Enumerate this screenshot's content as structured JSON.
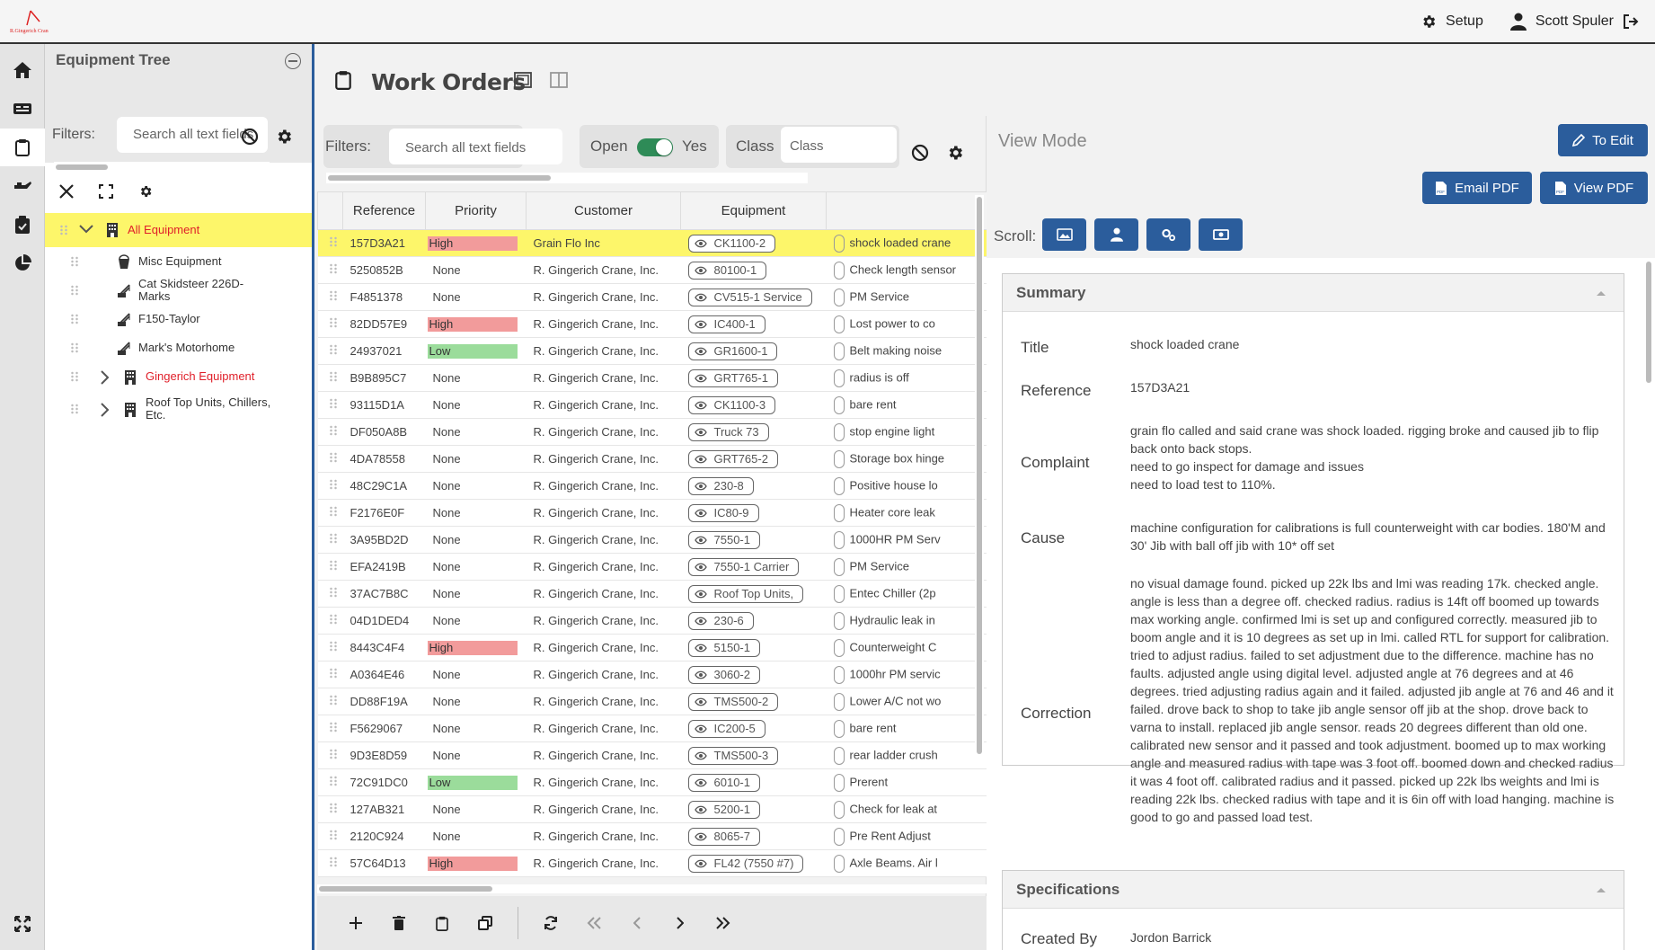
{
  "topbar": {
    "setup_label": "Setup",
    "user_name": "Scott Spuler"
  },
  "tree": {
    "title": "Equipment Tree",
    "filters_label": "Filters:",
    "search_placeholder": "Search all text fields",
    "items": [
      {
        "label": "All Equipment",
        "level": 0,
        "expanded": true,
        "selected": true,
        "icon": "building-icon",
        "color": "#e0202a"
      },
      {
        "label": "Misc Equipment",
        "level": 1,
        "icon": "bucket-icon",
        "color": "#333"
      },
      {
        "label": "Cat Skidsteer 226D- Marks",
        "level": 1,
        "icon": "crane-icon",
        "color": "#333"
      },
      {
        "label": "F150-Taylor",
        "level": 1,
        "icon": "crane-icon",
        "color": "#333"
      },
      {
        "label": "Mark's Motorhome",
        "level": 1,
        "icon": "crane-icon",
        "color": "#333"
      },
      {
        "label": "Gingerich Equipment",
        "level": 1,
        "collapsed": true,
        "icon": "building-icon",
        "color": "#e0202a"
      },
      {
        "label": "Roof Top Units, Chillers, Etc.",
        "level": 1,
        "collapsed": true,
        "icon": "building-icon",
        "color": "#333"
      }
    ]
  },
  "work_orders": {
    "title": "Work Orders",
    "filters_label": "Filters:",
    "search_placeholder": "Search all text fields",
    "open_label": "Open",
    "open_value": "Yes",
    "class_label": "Class",
    "class_placeholder": "Class",
    "columns": [
      "Reference",
      "Priority",
      "Customer",
      "Equipment"
    ],
    "rows": [
      {
        "ref": "157D3A21",
        "priority": "High",
        "customer": "Grain Flo Inc",
        "equipment": "CK1100-2",
        "desc": "shock loaded crane",
        "selected": true
      },
      {
        "ref": "5250852B",
        "priority": "None",
        "customer": "R. Gingerich Crane, Inc.",
        "equipment": "80100-1",
        "desc": "Check length sensor"
      },
      {
        "ref": "F4851378",
        "priority": "None",
        "customer": "R. Gingerich Crane, Inc.",
        "equipment": "CV515-1 Service",
        "desc": "PM Service"
      },
      {
        "ref": "82DD57E9",
        "priority": "High",
        "customer": "R. Gingerich Crane, Inc.",
        "equipment": "IC400-1",
        "desc": "Lost power to co"
      },
      {
        "ref": "24937021",
        "priority": "Low",
        "customer": "R. Gingerich Crane, Inc.",
        "equipment": "GR1600-1",
        "desc": "Belt making noise"
      },
      {
        "ref": "B9B895C7",
        "priority": "None",
        "customer": "R. Gingerich Crane, Inc.",
        "equipment": "GRT765-1",
        "desc": "radius is off"
      },
      {
        "ref": "93115D1A",
        "priority": "None",
        "customer": "R. Gingerich Crane, Inc.",
        "equipment": "CK1100-3",
        "desc": "bare rent"
      },
      {
        "ref": "DF050A8B",
        "priority": "None",
        "customer": "R. Gingerich Crane, Inc.",
        "equipment": "Truck 73",
        "desc": "stop engine light"
      },
      {
        "ref": "4DA78558",
        "priority": "None",
        "customer": "R. Gingerich Crane, Inc.",
        "equipment": "GRT765-2",
        "desc": "Storage box hinge"
      },
      {
        "ref": "48C29C1A",
        "priority": "None",
        "customer": "R. Gingerich Crane, Inc.",
        "equipment": "230-8",
        "desc": "Positive house lo"
      },
      {
        "ref": "F2176E0F",
        "priority": "None",
        "customer": "R. Gingerich Crane, Inc.",
        "equipment": "IC80-9",
        "desc": "Heater core leak"
      },
      {
        "ref": "3A95BD2D",
        "priority": "None",
        "customer": "R. Gingerich Crane, Inc.",
        "equipment": "7550-1",
        "desc": "1000HR PM Serv"
      },
      {
        "ref": "EFA2419B",
        "priority": "None",
        "customer": "R. Gingerich Crane, Inc.",
        "equipment": "7550-1 Carrier",
        "desc": "PM Service"
      },
      {
        "ref": "37AC7B8C",
        "priority": "None",
        "customer": "R. Gingerich Crane, Inc.",
        "equipment": "Roof Top Units,",
        "desc": "Entec Chiller (2p"
      },
      {
        "ref": "04D1DED4",
        "priority": "None",
        "customer": "R. Gingerich Crane, Inc.",
        "equipment": "230-6",
        "desc": "Hydraulic leak in"
      },
      {
        "ref": "8443C4F4",
        "priority": "High",
        "customer": "R. Gingerich Crane, Inc.",
        "equipment": "5150-1",
        "desc": "Counterweight C"
      },
      {
        "ref": "A0364E46",
        "priority": "None",
        "customer": "R. Gingerich Crane, Inc.",
        "equipment": "3060-2",
        "desc": "1000hr PM servic"
      },
      {
        "ref": "DD88F19A",
        "priority": "None",
        "customer": "R. Gingerich Crane, Inc.",
        "equipment": "TMS500-2",
        "desc": "Lower A/C not wo"
      },
      {
        "ref": "F5629067",
        "priority": "None",
        "customer": "R. Gingerich Crane, Inc.",
        "equipment": "IC200-5",
        "desc": "bare rent"
      },
      {
        "ref": "9D3E8D59",
        "priority": "None",
        "customer": "R. Gingerich Crane, Inc.",
        "equipment": "TMS500-3",
        "desc": "rear ladder crush"
      },
      {
        "ref": "72C91DC0",
        "priority": "Low",
        "customer": "R. Gingerich Crane, Inc.",
        "equipment": "6010-1",
        "desc": "Prerent"
      },
      {
        "ref": "127AB321",
        "priority": "None",
        "customer": "R. Gingerich Crane, Inc.",
        "equipment": "5200-1",
        "desc": "Check for leak at"
      },
      {
        "ref": "2120C924",
        "priority": "None",
        "customer": "R. Gingerich Crane, Inc.",
        "equipment": "8065-7",
        "desc": "Pre Rent   Adjust"
      },
      {
        "ref": "57C64D13",
        "priority": "High",
        "customer": "R. Gingerich Crane, Inc.",
        "equipment": "FL42 (7550 #7)",
        "desc": "Axle Beams. Air l"
      }
    ]
  },
  "detail": {
    "mode_label": "View Mode",
    "to_edit_label": "To Edit",
    "email_pdf_label": "Email PDF",
    "view_pdf_label": "View PDF",
    "scroll_label": "Scroll:",
    "summary_title": "Summary",
    "specifications_title": "Specifications",
    "title_label": "Title",
    "title_value": "shock loaded crane",
    "reference_label": "Reference",
    "reference_value": "157D3A21",
    "complaint_label": "Complaint",
    "complaint_value": "grain flo called and said crane was shock loaded. rigging broke and caused jib to flip back onto back stops.\nneed to go inspect for damage and issues\nneed to load test to 110%.",
    "cause_label": "Cause",
    "cause_value": "machine configuration for calibrations is full counterweight with car bodies. 180'M and 30' Jib with ball off jib with 10* off set",
    "correction_label": "Correction",
    "correction_value": "no visual damage found. picked up 22k lbs and lmi was reading 17k. checked angle. angle is less than a degree off. checked radius. radius is 14ft off boomed up towards max working angle. confirmed lmi is set up and configured correctly. measured jib to boom angle and it is 10 degrees as set up in lmi. called RTL for support for calibration. tried to adjust radius. failed to set adjustment due to the difference. machine has no faults. adjusted angle using digital level. adjusted angle at 76 degrees and at 46 degrees. tried adjusting radius again and it failed. adjusted jib angle at 76 and 46 and it failed. drove back to shop to take jib angle sensor off jib at the shop. drove back to varna to install. replaced jib angle sensor. reads 20 degrees different than old one. calibrated new sensor and it passed and took adjustment. boomed up to max working angle and measured radius with tape was 3 foot off. boomed down and checked radius it was 4 foot off. calibrated radius and it passed. picked up 22k lbs weights and lmi is reading 22k lbs. checked radius with tape and it is 6in off with load hanging. machine is good to go and passed load test.",
    "created_by_label": "Created By",
    "created_by_value": "Jordon Barrick"
  },
  "colors": {
    "accent": "#2b5d9c",
    "selected_row": "#fdf66a",
    "high": "#f29b9b",
    "low": "#9bdc9b",
    "brand_red": "#e0202a"
  }
}
